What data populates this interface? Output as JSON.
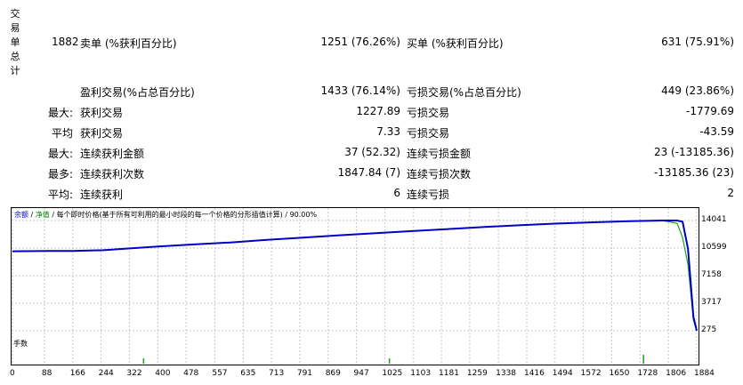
{
  "side_label": [
    "交",
    "易",
    "单",
    "总",
    "计"
  ],
  "stats": {
    "total_trades": "1882",
    "rows": [
      {
        "prefix": "",
        "l_label": "卖单 (%获利百分比)",
        "l_value": "1251 (76.26%)",
        "r_label": "买单 (%获利百分比)",
        "r_value": "631 (75.91%)"
      },
      {
        "prefix": "",
        "l_label": "盈利交易(%占总百分比)",
        "l_value": "1433 (76.14%)",
        "r_label": "亏损交易(%占总百分比)",
        "r_value": "449 (23.86%)"
      },
      {
        "prefix": "最大:",
        "l_label": "获利交易",
        "l_value": "1227.89",
        "r_label": "亏损交易",
        "r_value": "-1779.69"
      },
      {
        "prefix": "平均",
        "l_label": "获利交易",
        "l_value": "7.33",
        "r_label": "亏损交易",
        "r_value": "-43.59"
      },
      {
        "prefix": "最大:",
        "l_label": "连续获利金额",
        "l_value": "37 (52.32)",
        "r_label": "连续亏损金额",
        "r_value": "23 (-13185.36)"
      },
      {
        "prefix": "最多:",
        "l_label": "连续获利次数",
        "l_value": "1847.84 (7)",
        "r_label": "连续亏损次数",
        "r_value": "-13185.36 (23)"
      },
      {
        "prefix": "平均:",
        "l_label": "连续获利",
        "l_value": "6",
        "r_label": "连续亏损",
        "r_value": "2"
      }
    ]
  },
  "chart_legend": {
    "balance": "余额",
    "sep1": " / ",
    "equity": "净值",
    "rest": " / 每个即时价格(基于所有可利用的最小时段的每一个价格的分形插值计算) / 90.00%"
  },
  "lots_label": "手数",
  "colors": {
    "balance": "#0000c8",
    "equity": "#1ea01e",
    "grid": "#c8c8c8",
    "text_blue": "#0000ff",
    "text_green": "#008000"
  },
  "chart_data": {
    "type": "line",
    "y_ticks": [
      "14041",
      "10599",
      "7158",
      "3717",
      "275"
    ],
    "x_ticks": [
      "0",
      "88",
      "166",
      "244",
      "322",
      "400",
      "478",
      "557",
      "635",
      "713",
      "791",
      "869",
      "947",
      "1025",
      "1103",
      "1181",
      "1259",
      "1338",
      "1416",
      "1494",
      "1572",
      "1650",
      "1728",
      "1806",
      "1884"
    ],
    "ylim": [
      275,
      14041
    ],
    "xlim": [
      0,
      1884
    ],
    "series": [
      {
        "name": "余额",
        "x": [
          0,
          100,
          166,
          200,
          250,
          400,
          500,
          600,
          700,
          800,
          900,
          1000,
          1100,
          1200,
          1300,
          1400,
          1500,
          1600,
          1700,
          1790,
          1830,
          1845,
          1860,
          1875,
          1884
        ],
        "y": [
          10200,
          10230,
          10240,
          10280,
          10330,
          10800,
          11050,
          11300,
          11620,
          11900,
          12200,
          12460,
          12720,
          12980,
          13230,
          13460,
          13660,
          13820,
          13950,
          14041,
          14040,
          13900,
          10500,
          2000,
          275
        ]
      },
      {
        "name": "净值",
        "x": [
          0,
          100,
          166,
          250,
          400,
          500,
          600,
          700,
          800,
          900,
          1000,
          1100,
          1200,
          1300,
          1400,
          1500,
          1600,
          1700,
          1790,
          1830,
          1845,
          1860,
          1875,
          1884
        ],
        "y": [
          10200,
          10230,
          10240,
          10330,
          10800,
          11050,
          11300,
          11620,
          11900,
          12200,
          12460,
          12720,
          12980,
          13230,
          13460,
          13660,
          13820,
          13950,
          14041,
          13700,
          11900,
          8500,
          1600,
          275
        ]
      }
    ]
  }
}
